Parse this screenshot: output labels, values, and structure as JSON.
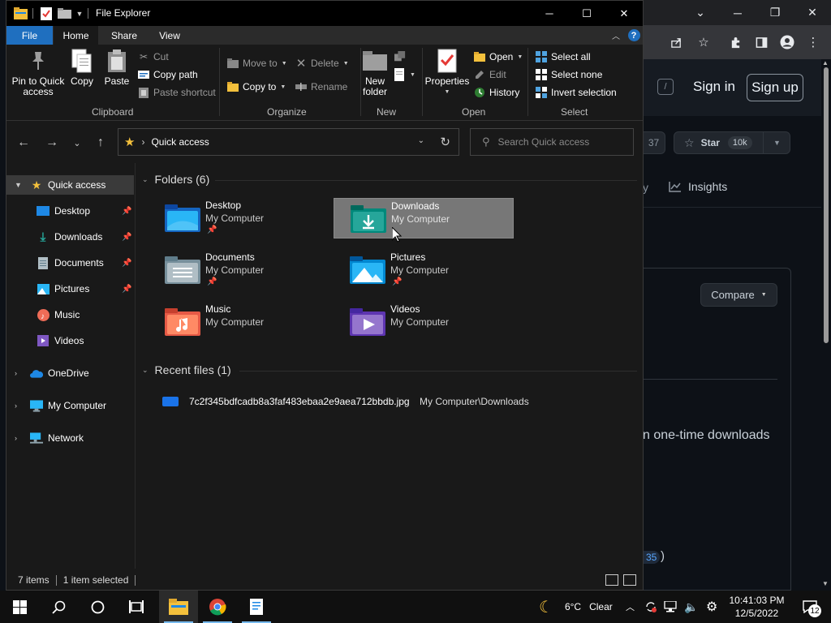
{
  "window": {
    "title": "File Explorer",
    "controls": {
      "minimize": "─",
      "maximize": "☐",
      "close": "✕"
    }
  },
  "ribbon_tabs": [
    "File",
    "Home",
    "Share",
    "View"
  ],
  "ribbon": {
    "clipboard": {
      "pin_label": "Pin to Quick access",
      "copy": "Copy",
      "paste": "Paste",
      "cut": "Cut",
      "copy_path": "Copy path",
      "paste_shortcut": "Paste shortcut",
      "group": "Clipboard"
    },
    "organize": {
      "move_to": "Move to",
      "copy_to": "Copy to",
      "delete": "Delete",
      "rename": "Rename",
      "group": "Organize"
    },
    "new": {
      "new_folder": "New folder",
      "group": "New"
    },
    "open": {
      "properties": "Properties",
      "open": "Open",
      "edit": "Edit",
      "history": "History",
      "group": "Open"
    },
    "select": {
      "select_all": "Select all",
      "select_none": "Select none",
      "invert_selection": "Invert selection",
      "group": "Select"
    }
  },
  "address": {
    "location": "Quick access",
    "search_placeholder": "Search Quick access"
  },
  "nav": [
    {
      "label": "Quick access",
      "icon": "star-icon"
    },
    {
      "label": "Desktop",
      "icon": "desktop-icon",
      "pinned": true
    },
    {
      "label": "Downloads",
      "icon": "download-icon",
      "pinned": true
    },
    {
      "label": "Documents",
      "icon": "documents-icon",
      "pinned": true
    },
    {
      "label": "Pictures",
      "icon": "pictures-icon",
      "pinned": true
    },
    {
      "label": "Music",
      "icon": "music-icon"
    },
    {
      "label": "Videos",
      "icon": "videos-icon"
    },
    {
      "label": "OneDrive",
      "icon": "cloud-icon"
    },
    {
      "label": "My Computer",
      "icon": "computer-icon"
    },
    {
      "label": "Network",
      "icon": "network-icon"
    }
  ],
  "content": {
    "folders_header": "Folders (6)",
    "folders": [
      {
        "name": "Desktop",
        "location": "My Computer",
        "pinned": true
      },
      {
        "name": "Downloads",
        "location": "My Computer",
        "pinned": true,
        "selected": true
      },
      {
        "name": "Documents",
        "location": "My Computer",
        "pinned": true
      },
      {
        "name": "Pictures",
        "location": "My Computer",
        "pinned": true
      },
      {
        "name": "Music",
        "location": "My Computer"
      },
      {
        "name": "Videos",
        "location": "My Computer"
      }
    ],
    "recent_header": "Recent files (1)",
    "recent": [
      {
        "name": "7c2f345bdfcadb8a3faf483ebaa2e9aea712bbdb.jpg",
        "path": "My Computer\\Downloads"
      }
    ]
  },
  "status": {
    "items": "7 items",
    "selected": "1 item selected"
  },
  "browser_bg": {
    "slash": "/",
    "sign_in": "Sign in",
    "sign_up": "Sign up",
    "count": "37",
    "star": "Star",
    "star_count": "10k",
    "tab_partial": "y",
    "insights": "Insights",
    "compare": "Compare",
    "description": "n one-time downloads",
    "tag": "35",
    "paren": ")"
  },
  "taskbar": {
    "weather_temp": "6°C",
    "weather_text": "Clear",
    "time": "10:41:03 PM",
    "date": "12/5/2022",
    "notifications": "12"
  },
  "colors": {
    "accent": "#1f6fbf",
    "selection": "#777777",
    "background": "#191919"
  }
}
